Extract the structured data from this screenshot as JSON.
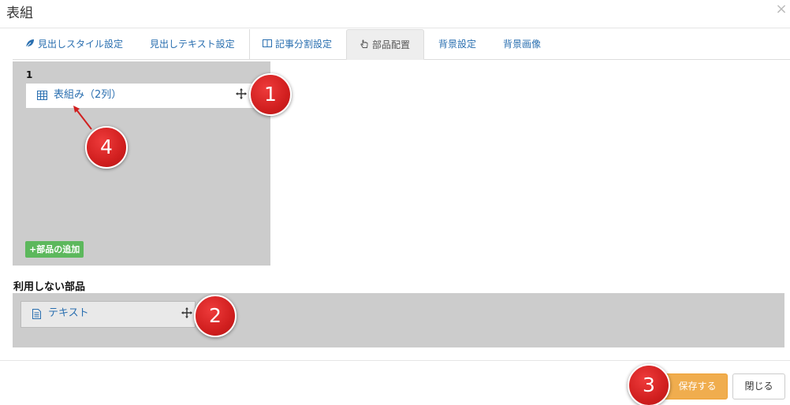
{
  "dialog": {
    "title": "表組",
    "close_glyph": "×"
  },
  "tabs": [
    {
      "label": "見出しスタイル設定",
      "icon": "leaf-icon",
      "active": false
    },
    {
      "label": "見出しテキスト設定",
      "icon": null,
      "active": false
    },
    {
      "label": "記事分割設定",
      "icon": "columns-icon",
      "active": false
    },
    {
      "label": "部品配置",
      "icon": "hand-pointer-icon",
      "active": true
    },
    {
      "label": "背景設定",
      "icon": null,
      "active": false
    },
    {
      "label": "背景画像",
      "icon": null,
      "active": false
    }
  ],
  "layout": {
    "column_number": "1",
    "placed_parts": [
      {
        "label": "表組み（2列）",
        "icon": "table-icon"
      }
    ],
    "add_part_label": "+部品の追加"
  },
  "unused": {
    "heading": "利用しない部品",
    "parts": [
      {
        "label": "テキスト",
        "icon": "document-icon"
      }
    ]
  },
  "footer": {
    "save_label": "保存する",
    "close_label": "閉じる"
  },
  "callouts": [
    "1",
    "2",
    "3",
    "4"
  ],
  "colors": {
    "link": "#2a6fb0",
    "save": "#f0ad4e",
    "add_part": "#5cb85c",
    "drop_area": "#cccccc",
    "callout": "#d11f1f"
  }
}
